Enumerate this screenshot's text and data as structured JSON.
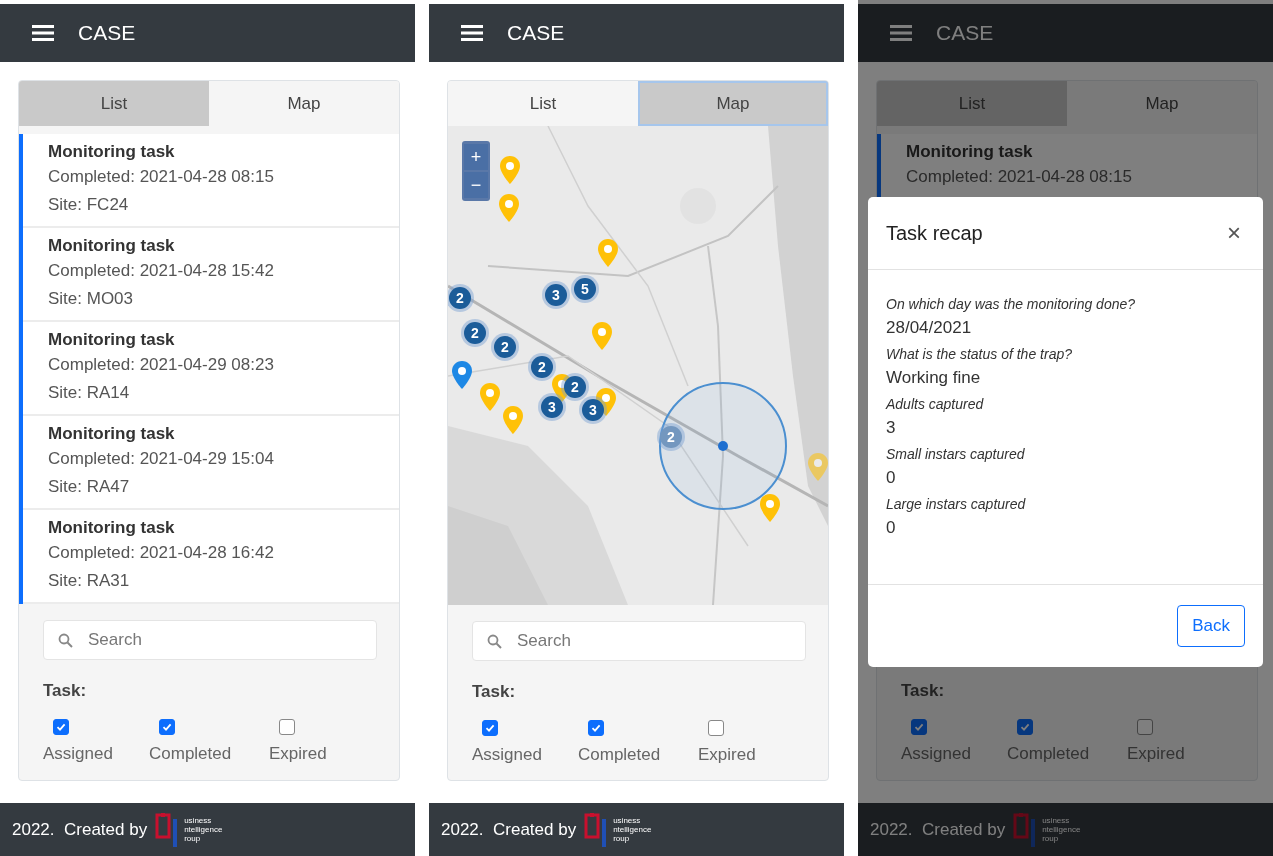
{
  "screens": [
    {
      "kind": "list",
      "app_title": "CASE",
      "tabs": [
        {
          "label": "List",
          "selected": true
        },
        {
          "label": "Map",
          "selected": false
        }
      ],
      "tasks": [
        {
          "title": "Monitoring task",
          "completed": "Completed: 2021-04-28 08:15",
          "site": "Site: FC24"
        },
        {
          "title": "Monitoring task",
          "completed": "Completed: 2021-04-28 15:42",
          "site": "Site: MO03"
        },
        {
          "title": "Monitoring task",
          "completed": "Completed: 2021-04-29 08:23",
          "site": "Site: RA14"
        },
        {
          "title": "Monitoring task",
          "completed": "Completed: 2021-04-29 15:04",
          "site": "Site: RA47"
        },
        {
          "title": "Monitoring task",
          "completed": "Completed: 2021-04-28 16:42",
          "site": "Site: RA31"
        }
      ],
      "search": {
        "placeholder": "Search"
      },
      "filter": {
        "label": "Task:",
        "options": [
          {
            "label": "Assigned",
            "checked": true
          },
          {
            "label": "Completed",
            "checked": true
          },
          {
            "label": "Expired",
            "checked": false
          }
        ]
      },
      "footer": {
        "text": "2022.  Created by",
        "logo_lines": [
          "usiness",
          "ntelligence",
          "roup"
        ]
      }
    },
    {
      "kind": "map",
      "app_title": "CASE",
      "tabs": [
        {
          "label": "List",
          "selected": false
        },
        {
          "label": "Map",
          "selected": true
        }
      ],
      "map": {
        "kind": "picture",
        "zoom_buttons": [
          "+",
          "−"
        ],
        "clusters": [
          {
            "count": "2",
            "dimmed": false
          },
          {
            "count": "3",
            "dimmed": false
          },
          {
            "count": "5",
            "dimmed": false
          },
          {
            "count": "2",
            "dimmed": false
          },
          {
            "count": "2",
            "dimmed": false
          },
          {
            "count": "2",
            "dimmed": false
          },
          {
            "count": "2",
            "dimmed": false
          },
          {
            "count": "3",
            "dimmed": false
          },
          {
            "count": "3",
            "dimmed": false
          },
          {
            "count": "2",
            "dimmed": true
          }
        ]
      },
      "search": {
        "placeholder": "Search"
      },
      "filter": {
        "label": "Task:",
        "options": [
          {
            "label": "Assigned",
            "checked": true
          },
          {
            "label": "Completed",
            "checked": true
          },
          {
            "label": "Expired",
            "checked": false
          }
        ]
      },
      "footer": {
        "text": "2022.  Created by",
        "logo_lines": [
          "usiness",
          "ntelligence",
          "roup"
        ]
      }
    },
    {
      "kind": "list",
      "dimmed": true,
      "app_title": "CASE",
      "tabs": [
        {
          "label": "List",
          "selected": true
        },
        {
          "label": "Map",
          "selected": false
        }
      ],
      "tasks": [
        {
          "title": "Monitoring task",
          "completed": "Completed: 2021-04-28 08:15"
        }
      ],
      "filter": {
        "label": "Task:",
        "options": [
          {
            "label": "Assigned",
            "checked": true
          },
          {
            "label": "Completed",
            "checked": true
          },
          {
            "label": "Expired",
            "checked": false
          }
        ]
      },
      "footer": {
        "text": "2022.  Created by",
        "logo_lines": [
          "usiness",
          "ntelligence",
          "roup"
        ]
      },
      "modal": {
        "title": "Task recap",
        "close": "×",
        "fields": [
          {
            "question": "On which day was the monitoring done?",
            "answer": "28/04/2021"
          },
          {
            "question": "What is the status of the trap?",
            "answer": "Working fine"
          },
          {
            "question": "Adults captured",
            "answer": "3"
          },
          {
            "question": "Small instars captured",
            "answer": "0"
          },
          {
            "question": "Large instars captured",
            "answer": "0"
          }
        ],
        "button": "Back"
      }
    }
  ]
}
